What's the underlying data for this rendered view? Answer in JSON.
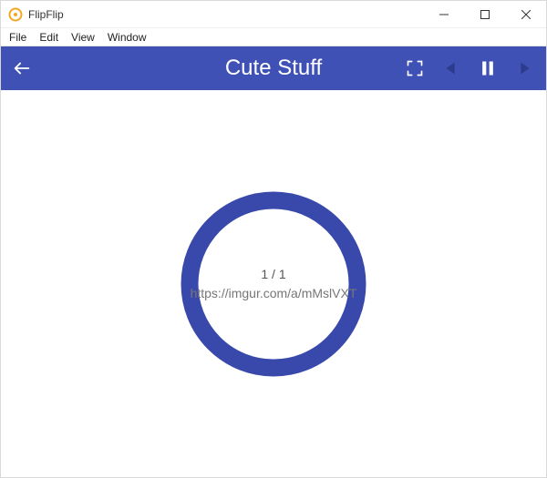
{
  "window": {
    "title": "FlipFlip"
  },
  "menubar": {
    "items": [
      "File",
      "Edit",
      "View",
      "Window"
    ]
  },
  "header": {
    "title": "Cute Stuff"
  },
  "loader": {
    "progress_text": "1 / 1",
    "url": "https://imgur.com/a/mMslVXT"
  }
}
